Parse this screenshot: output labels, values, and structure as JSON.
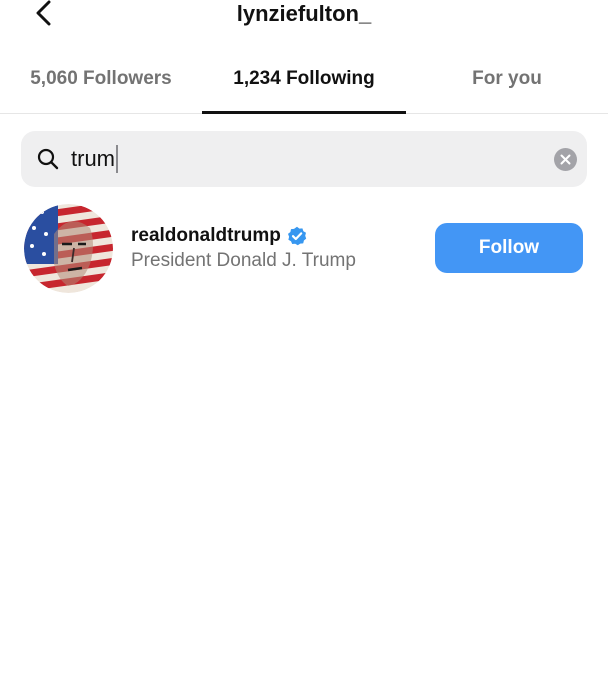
{
  "header": {
    "title": "lynziefulton_",
    "back_icon": "chevron-left-icon"
  },
  "tabs": [
    {
      "label": "5,060 Followers",
      "active": false
    },
    {
      "label": "1,234 Following",
      "active": true
    },
    {
      "label": "For you",
      "active": false
    }
  ],
  "search": {
    "value": "trum",
    "icon": "search-icon",
    "clear_icon": "clear-icon"
  },
  "results": [
    {
      "username": "realdonaldtrump",
      "verified": true,
      "full_name": "President Donald J. Trump",
      "action_label": "Follow"
    }
  ],
  "colors": {
    "follow_button": "#4396f5",
    "verified_badge": "#3797f0",
    "secondary_text": "#737373",
    "search_background": "#efeff0"
  }
}
